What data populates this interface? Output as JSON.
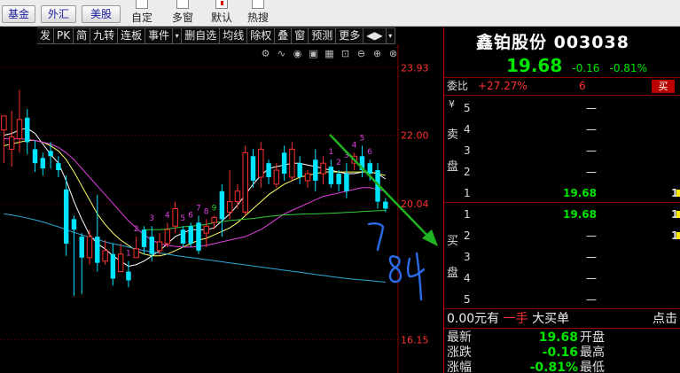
{
  "topbar": {
    "markets": [
      "基金",
      "外汇",
      "美股"
    ],
    "tools": [
      "自定",
      "多窗",
      "默认",
      "热搜"
    ]
  },
  "toolbar2": [
    "发",
    "PK",
    "简",
    "九转",
    "连板",
    "事件",
    "▾",
    "删自选",
    "均线",
    "除权",
    "叠",
    "窗",
    "预测",
    "更多",
    "◀▶",
    "▾"
  ],
  "chart_icons": [
    "gear-icon",
    "curve-icon",
    "eye-icon",
    "cube-icon",
    "calendar-icon",
    "lock-icon",
    "minus-icon",
    "plus-icon",
    "close-icon"
  ],
  "chart_data": {
    "type": "candlestick",
    "ytick_labels": [
      "23.93",
      "22.00",
      "20.04",
      "16.15"
    ],
    "ylim": [
      15.2,
      24.6
    ],
    "candles": [
      [
        22.15,
        22.55,
        22.4,
        21.2
      ],
      [
        21.6,
        21.95,
        22.7,
        21.1
      ],
      [
        21.9,
        22.45,
        23.3,
        21.5
      ],
      [
        22.5,
        21.8,
        22.75,
        21.45
      ],
      [
        21.6,
        21.2,
        21.85,
        20.95
      ],
      [
        21.35,
        21.05,
        21.5,
        20.85
      ],
      [
        21.55,
        21.4,
        21.8,
        21.05
      ],
      [
        21.2,
        21.0,
        21.4,
        20.8
      ],
      [
        20.45,
        18.9,
        20.85,
        18.55
      ],
      [
        19.6,
        19.3,
        19.7,
        17.4
      ],
      [
        19.1,
        18.5,
        19.2,
        17.45
      ],
      [
        18.5,
        19.1,
        19.3,
        18.3
      ],
      [
        19.1,
        18.35,
        20.3,
        18.1
      ],
      [
        18.4,
        18.7,
        19.0,
        18.3
      ],
      [
        18.6,
        17.9,
        18.9,
        17.7
      ],
      [
        18.1,
        18.6,
        18.9,
        18.1
      ],
      [
        18.1,
        17.85,
        18.4,
        17.65
      ],
      [
        18.5,
        18.75,
        19.1,
        18.5
      ],
      [
        19.3,
        18.8,
        19.4,
        18.6
      ],
      [
        19.1,
        18.6,
        19.4,
        18.4
      ],
      [
        18.7,
        18.95,
        19.2,
        18.6
      ],
      [
        18.9,
        19.3,
        19.5,
        18.8
      ],
      [
        19.4,
        19.9,
        20.1,
        19.2
      ],
      [
        19.3,
        18.9,
        19.4,
        18.8
      ],
      [
        19.4,
        18.9,
        19.5,
        18.8
      ],
      [
        19.5,
        18.7,
        19.7,
        18.6
      ],
      [
        19.2,
        19.4,
        19.6,
        18.8
      ],
      [
        19.5,
        19.65,
        19.7,
        19.3
      ],
      [
        20.4,
        19.6,
        20.6,
        19.1
      ],
      [
        19.8,
        20.1,
        21.0,
        19.6
      ],
      [
        20.1,
        20.4,
        20.6,
        19.9
      ],
      [
        19.8,
        21.5,
        21.7,
        19.7
      ],
      [
        21.4,
        20.7,
        21.6,
        20.5
      ],
      [
        20.8,
        21.6,
        21.8,
        20.5
      ],
      [
        21.2,
        20.8,
        21.3,
        20.6
      ],
      [
        20.6,
        21.0,
        21.2,
        20.5
      ],
      [
        21.5,
        20.9,
        21.7,
        20.7
      ],
      [
        20.8,
        21.6,
        21.8,
        20.7
      ],
      [
        21.2,
        20.8,
        21.4,
        20.6
      ],
      [
        20.7,
        20.9,
        21.0,
        20.5
      ],
      [
        21.3,
        20.7,
        21.6,
        20.4
      ],
      [
        20.9,
        21.2,
        21.4,
        20.6
      ],
      [
        21.1,
        20.6,
        21.3,
        20.5
      ],
      [
        20.9,
        20.6,
        21.0,
        20.4
      ],
      [
        20.9,
        20.4,
        21.2,
        20.2
      ],
      [
        21.2,
        21.4,
        21.5,
        21.0
      ],
      [
        21.4,
        21.0,
        21.7,
        20.8
      ],
      [
        21.2,
        20.9,
        21.3,
        20.7
      ],
      [
        21.0,
        20.1,
        21.2,
        19.9
      ],
      [
        20.1,
        19.9,
        20.2,
        19.8
      ]
    ],
    "ma_lines": [
      {
        "color": "#ffffff",
        "values": [
          22.0,
          22.05,
          22.15,
          22.2,
          22.05,
          21.75,
          21.45,
          21.2,
          20.7,
          20.1,
          19.6,
          19.15,
          18.9,
          18.75,
          18.55,
          18.4,
          18.25,
          18.3,
          18.4,
          18.55,
          18.7,
          18.9,
          19.1,
          19.2,
          19.3,
          19.3,
          19.3,
          19.35,
          19.55,
          19.75,
          20.0,
          20.3,
          20.6,
          20.85,
          21.05,
          21.1,
          21.15,
          21.2,
          21.2,
          21.15,
          21.1,
          21.05,
          21.0,
          20.95,
          20.9,
          20.9,
          20.95,
          20.95,
          20.9,
          20.75
        ]
      },
      {
        "color": "#ffff66",
        "values": [
          21.7,
          21.75,
          21.8,
          21.85,
          21.85,
          21.8,
          21.7,
          21.55,
          21.3,
          20.95,
          20.55,
          20.15,
          19.75,
          19.45,
          19.2,
          19.0,
          18.85,
          18.7,
          18.6,
          18.55,
          18.55,
          18.6,
          18.7,
          18.8,
          18.9,
          19.0,
          19.05,
          19.15,
          19.25,
          19.35,
          19.5,
          19.7,
          19.9,
          20.1,
          20.3,
          20.45,
          20.6,
          20.7,
          20.8,
          20.85,
          20.9,
          20.95,
          20.95,
          20.95,
          20.95,
          20.95,
          20.95,
          20.95,
          20.9,
          20.85
        ]
      },
      {
        "color": "#e040e0",
        "values": [
          21.9,
          21.9,
          21.9,
          21.88,
          21.85,
          21.8,
          21.75,
          21.65,
          21.5,
          21.3,
          21.05,
          20.8,
          20.55,
          20.3,
          20.05,
          19.8,
          19.55,
          19.35,
          19.15,
          19.0,
          18.9,
          18.85,
          18.82,
          18.8,
          18.8,
          18.82,
          18.85,
          18.9,
          18.95,
          19.0,
          19.05,
          19.1,
          19.2,
          19.3,
          19.45,
          19.6,
          19.75,
          19.85,
          19.95,
          20.05,
          20.15,
          20.25,
          20.3,
          20.35,
          20.4,
          20.45,
          20.5,
          20.5,
          20.45,
          20.4
        ]
      },
      {
        "color": "#33cc33",
        "values": [
          null,
          null,
          null,
          null,
          null,
          null,
          null,
          null,
          null,
          null,
          null,
          null,
          null,
          null,
          null,
          null,
          null,
          null,
          19.3,
          19.3,
          19.3,
          19.32,
          19.35,
          19.38,
          19.4,
          19.42,
          19.45,
          19.5,
          19.53,
          19.56,
          19.58,
          19.6,
          19.62,
          19.65,
          19.68,
          19.7,
          19.72,
          19.73,
          19.74,
          19.75,
          19.75,
          19.76,
          19.77,
          19.78,
          19.79,
          19.8,
          19.82,
          19.83,
          19.84,
          19.85
        ]
      },
      {
        "color": "#2ba8d8",
        "values": [
          19.75,
          19.72,
          19.68,
          19.63,
          19.58,
          19.52,
          19.45,
          19.38,
          19.3,
          19.22,
          19.15,
          19.08,
          19.02,
          18.95,
          18.9,
          18.85,
          18.8,
          18.75,
          18.7,
          18.67,
          18.63,
          18.6,
          18.56,
          18.53,
          18.5,
          18.47,
          18.44,
          18.41,
          18.38,
          18.35,
          18.32,
          18.29,
          18.26,
          18.23,
          18.2,
          18.17,
          18.14,
          18.11,
          18.08,
          18.05,
          18.02,
          17.99,
          17.96,
          17.93,
          17.9,
          17.88,
          17.86,
          17.84,
          17.82,
          17.8
        ]
      }
    ],
    "markers": [
      {
        "i": 16,
        "text": "1",
        "color": "#e040e0"
      },
      {
        "i": 17,
        "text": "2",
        "color": "#e040e0"
      },
      {
        "i": 19,
        "text": "3",
        "color": "#e040e0"
      },
      {
        "i": 21,
        "text": "4",
        "color": "#e040e0"
      },
      {
        "i": 23,
        "text": "5",
        "color": "#e040e0"
      },
      {
        "i": 24,
        "text": "6",
        "color": "#e040e0"
      },
      {
        "i": 25,
        "text": "7",
        "color": "#e040e0"
      },
      {
        "i": 26,
        "text": "8",
        "color": "#e040e0"
      },
      {
        "i": 27,
        "text": "9",
        "color": "#33cc33"
      },
      {
        "i": 42,
        "text": "1",
        "color": "#e040e0"
      },
      {
        "i": 43,
        "text": "2",
        "color": "#e040e0"
      },
      {
        "i": 44,
        "text": "3",
        "color": "#e040e0"
      },
      {
        "i": 45,
        "text": "4",
        "color": "#e040e0"
      },
      {
        "i": 46,
        "text": "5",
        "color": "#e040e0"
      },
      {
        "i": 47,
        "text": "6",
        "color": "#e040e0"
      }
    ],
    "handwriting": "84"
  },
  "panel": {
    "title": "鑫铂股份 003038",
    "price": "19.68",
    "change": "-0.16",
    "change_pct": "-0.81%",
    "weibi_label": "委比",
    "weibi_value": "+27.27%",
    "weicha_value": "6",
    "sell_button": "买",
    "sell_side_label": [
      "卖",
      "盘"
    ],
    "buy_side_label": [
      "买",
      "盘"
    ],
    "yen_label": "¥",
    "sell_levels": [
      {
        "level": "5",
        "price": "—",
        "volume": ""
      },
      {
        "level": "4",
        "price": "—",
        "volume": ""
      },
      {
        "level": "3",
        "price": "—",
        "volume": ""
      },
      {
        "level": "2",
        "price": "—",
        "volume": ""
      },
      {
        "level": "1",
        "price": "19.68",
        "volume": "1"
      }
    ],
    "buy_levels": [
      {
        "level": "1",
        "price": "19.68",
        "volume": "1"
      },
      {
        "level": "2",
        "price": "—",
        "volume": "1"
      },
      {
        "level": "3",
        "price": "—",
        "volume": ""
      },
      {
        "level": "4",
        "price": "—",
        "volume": ""
      },
      {
        "level": "5",
        "price": "—",
        "volume": ""
      }
    ],
    "summary": {
      "amount": "0.00元有",
      "hands": "一手",
      "big": "大买单",
      "click": "点击"
    },
    "quotes": [
      {
        "label": "最新",
        "value": "19.68",
        "right": "开盘"
      },
      {
        "label": "涨跌",
        "value": "-0.16",
        "right": "最高"
      },
      {
        "label": "涨幅",
        "value": "-0.81%",
        "right": "最低"
      }
    ]
  },
  "colors": {
    "up": "#ff3030",
    "down": "#00e5ff",
    "accent_green": "#00e600",
    "panel_red": "#8a0000"
  }
}
